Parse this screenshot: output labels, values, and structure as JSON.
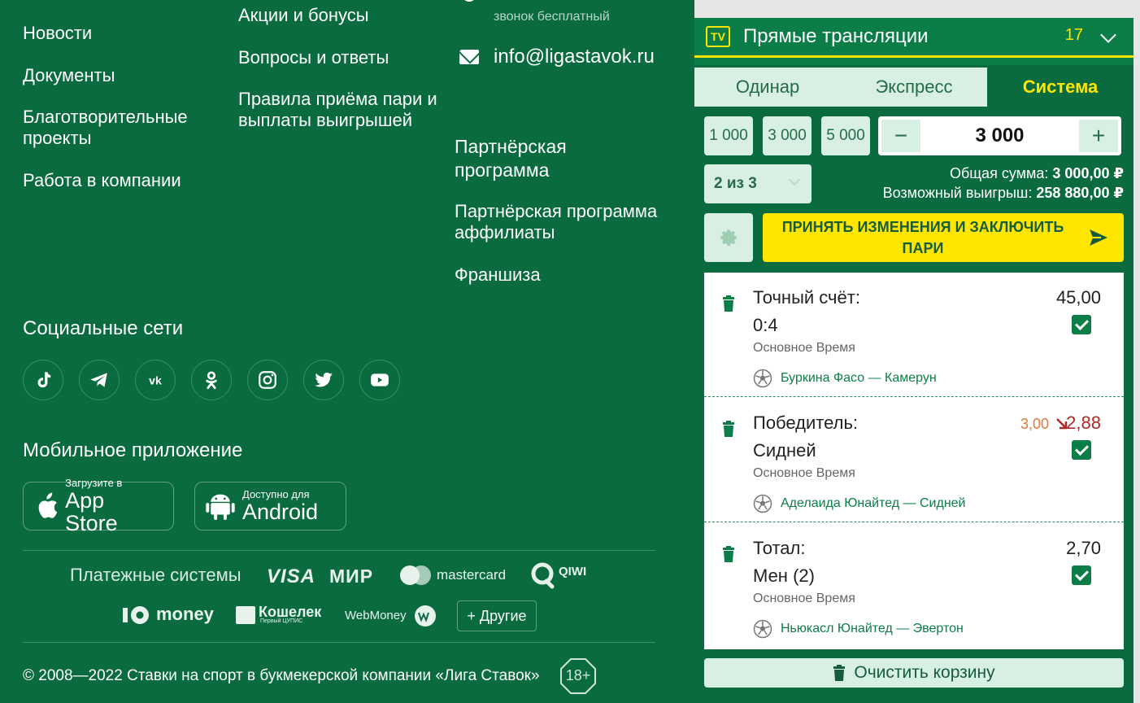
{
  "footer": {
    "col1": [
      "Новости",
      "Документы",
      "Благотворительные проекты",
      "Работа в компании"
    ],
    "col2": [
      "Акции и бонусы",
      "Вопросы и ответы",
      "Правила приёма пари и выплаты выигрышей"
    ],
    "col3": [
      "Партнёрская программа",
      "Партнёрская программа аффилиаты",
      "Франшиза"
    ],
    "contact_note": "звонок бесплатный",
    "email": "info@ligastavok.ru",
    "social_title": "Социальные сети",
    "socials": [
      "tiktok-icon",
      "telegram-icon",
      "vk-icon",
      "odnoklassniki-icon",
      "instagram-icon",
      "twitter-icon",
      "youtube-icon"
    ],
    "mobile_title": "Мобильное приложение",
    "appstore": {
      "sub": "Загрузите в",
      "main": "App Store"
    },
    "android": {
      "sub": "Доступно для",
      "main": "Android"
    },
    "payments_title": "Платежные системы",
    "payments": {
      "visa": "VISA",
      "mir": "МИР",
      "mastercard": "mastercard",
      "qiwi": "QIWI",
      "yoomoney": "money",
      "koshelek": "Кошелек",
      "koshelek_sub": "Первый ЦУПИС",
      "webmoney": "WebMoney"
    },
    "others_label": "+ Другие",
    "copyright": "© 2008—2022 Ставки на спорт в букмекерской компании «Лига Ставок»",
    "age": "18+"
  },
  "panel": {
    "live_icon": "TV",
    "live_title": "Прямые трансляции",
    "live_count": "17",
    "tabs": [
      "Одинар",
      "Экспресс",
      "Система"
    ],
    "active_tab": "Система",
    "quick_stakes": [
      "1 000",
      "3 000",
      "5 000"
    ],
    "stake_value": "3 000",
    "minus": "−",
    "plus": "+",
    "system_value": "2 из 3",
    "total_label": "Общая сумма:",
    "total_value": "3 000,00 ₽",
    "win_label": "Возможный выигрыш:",
    "win_value": "258 880,00 ₽",
    "accept_label": "ПРИНЯТЬ ИЗМЕНЕНИЯ И ЗАКЛЮЧИТЬ ПАРИ",
    "bets": [
      {
        "type": "Точный счёт:",
        "selection": "0:4",
        "odd": "45,00",
        "period": "Основное Время",
        "match": "Буркина Фасо — Камерун"
      },
      {
        "type": "Победитель:",
        "selection": "Сидней",
        "old_odd": "3,00",
        "odd": "2,88",
        "period": "Основное Время",
        "match": "Аделаида Юнайтед — Сидней"
      },
      {
        "type": "Тотал:",
        "selection": "Мен (2)",
        "odd": "2,70",
        "period": "Основное Время",
        "match": "Ньюкасл Юнайтед — Эвертон"
      }
    ],
    "clear_label": "Очистить корзину",
    "colors": {
      "brand_green": "#0a6b3f",
      "accent_yellow": "#ffe600",
      "odd_down": "#b32626",
      "odd_old": "#e07a3c"
    }
  }
}
